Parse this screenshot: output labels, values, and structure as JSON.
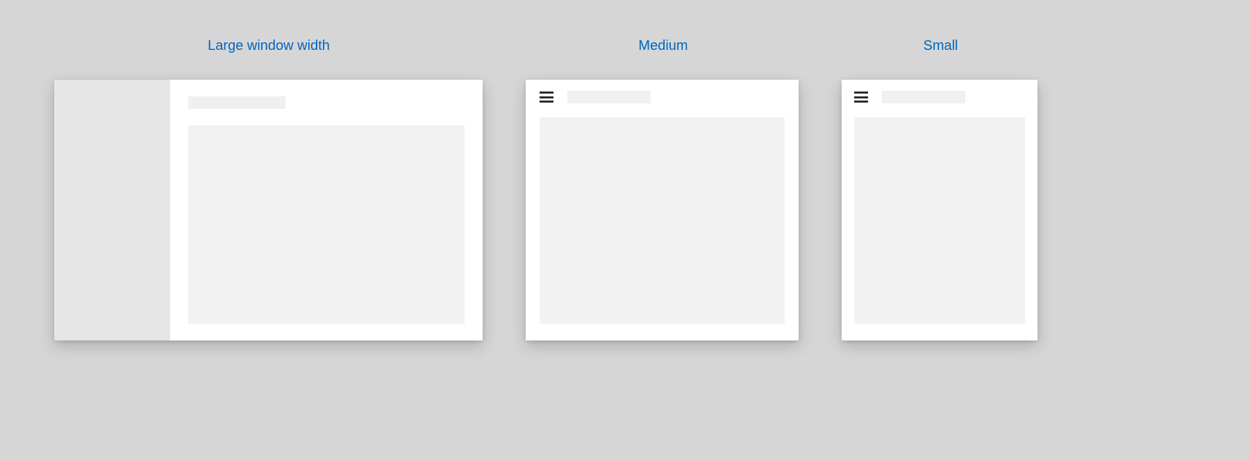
{
  "labels": {
    "large": "Large window width",
    "medium": "Medium",
    "small": "Small"
  },
  "colors": {
    "accent": "#0067c0",
    "page_bg": "#d6d6d6",
    "frame_bg": "#ffffff",
    "sidebar_bg": "#e6e6e6",
    "placeholder_bg": "#f0f0f0",
    "content_bg": "#f2f2f2",
    "hamburger": "#2b2b2b"
  }
}
